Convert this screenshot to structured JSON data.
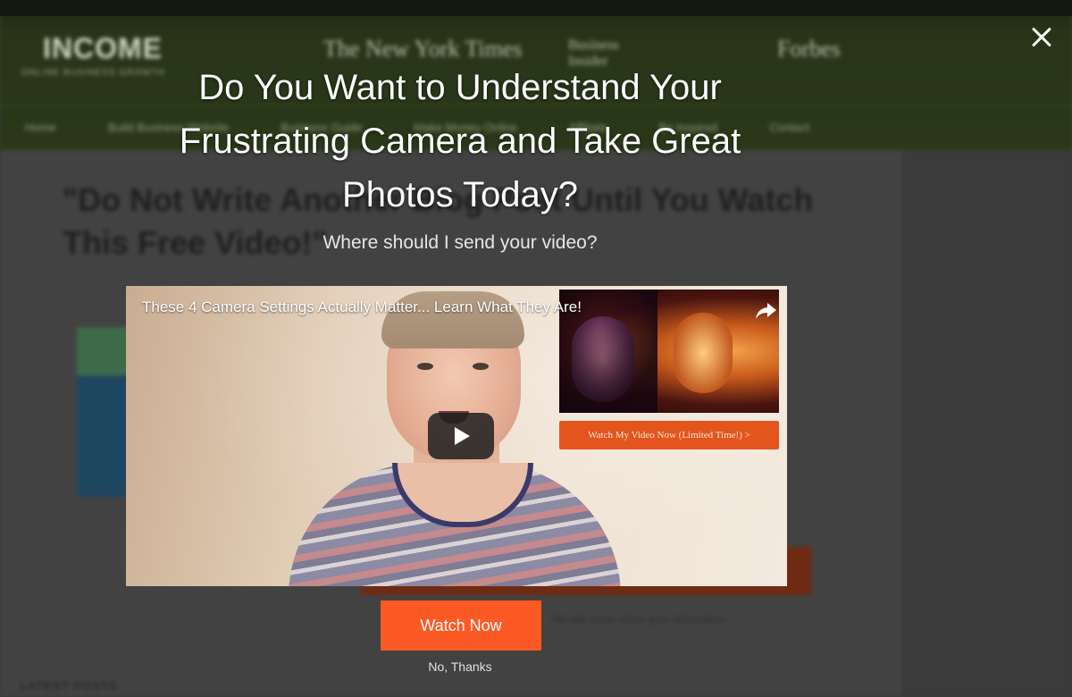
{
  "background": {
    "logo": "INCOME",
    "logo_tagline": "ONLINE BUSINESS GROWTH",
    "press": [
      "The New York Times",
      "Business Insider",
      "Forbes"
    ],
    "nav": [
      "Home",
      "Build Business Website",
      "Business Guide",
      "Make Money Online",
      "Affiliate",
      "Be Inspired",
      "Contact"
    ],
    "headline": "\"Do Not Write Another Blog Post Until You Watch This Free Video!\"",
    "optin_note": "We will never share your information.",
    "latest_posts": "LATEST POSTS"
  },
  "modal": {
    "headline": "Do You Want to Understand Your Frustrating Camera and Take Great Photos Today?",
    "subheadline": "Where should I send your video?",
    "video": {
      "title": "These 4 Camera Settings Actually Matter... Learn What They Are!",
      "thumbnail_cta": "Watch My Video Now (Limited Time!) >"
    },
    "watch_button": "Watch Now",
    "no_thanks": "No, Thanks"
  },
  "colors": {
    "cta": "#fb5a25",
    "header_bg": "#2a3819",
    "overlay_bg": "#3a3a3a"
  },
  "icons": [
    "close-icon",
    "share-icon",
    "play-icon"
  ]
}
